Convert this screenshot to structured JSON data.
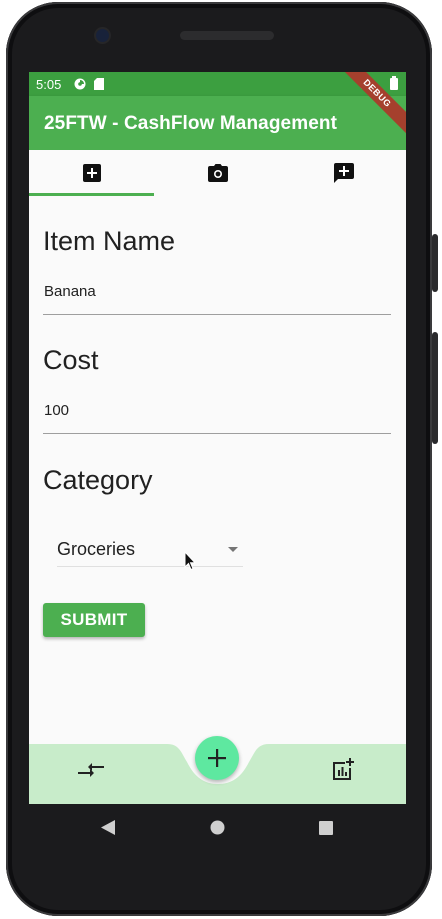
{
  "status_bar": {
    "time": "5:05"
  },
  "app_bar": {
    "title": "25FTW - CashFlow Management",
    "debug_banner": "DEBUG"
  },
  "tabs": [
    {
      "icon": "add-box-icon",
      "selected": true
    },
    {
      "icon": "camera-icon",
      "selected": false
    },
    {
      "icon": "add-comment-icon",
      "selected": false
    }
  ],
  "form": {
    "item_name_label": "Item Name",
    "item_name_value": "Banana",
    "cost_label": "Cost",
    "cost_value": "100",
    "category_label": "Category",
    "category_selected": "Groceries",
    "submit_label": "SUBMIT"
  },
  "bottom_nav": {
    "left_icon": "compare-arrows-icon",
    "fab_icon": "plus-icon",
    "right_icon": "add-chart-icon"
  },
  "colors": {
    "primary": "#4caf50",
    "status_bar": "#3c9f40",
    "fab": "#5ee8a0",
    "bottom_bar": "#c8ecca"
  }
}
